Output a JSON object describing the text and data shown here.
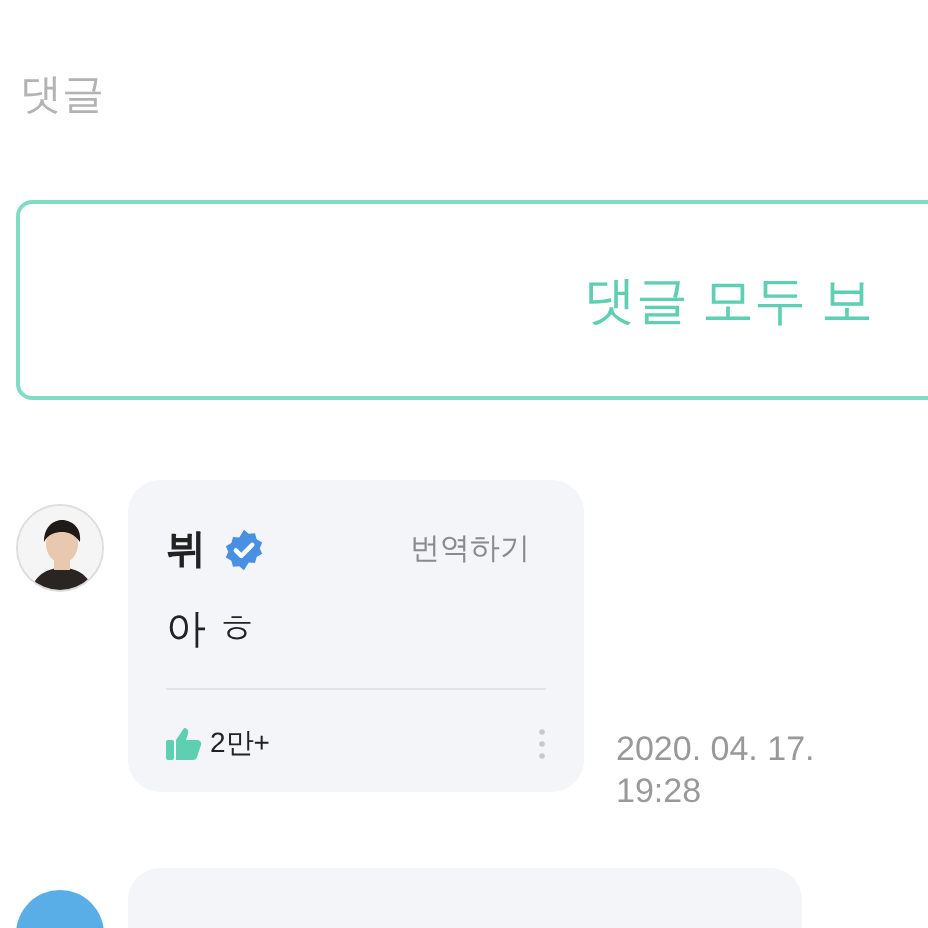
{
  "section_title": "댓글",
  "view_all_button": {
    "label": "댓글 모두 보"
  },
  "comments": [
    {
      "kind": "full",
      "author": "뷔",
      "verified": true,
      "translate": "번역하기",
      "text": "아 ㅎ",
      "likes": "2만+",
      "date": "2020. 04. 17. 19:28"
    },
    {
      "kind": "cut"
    }
  ]
}
